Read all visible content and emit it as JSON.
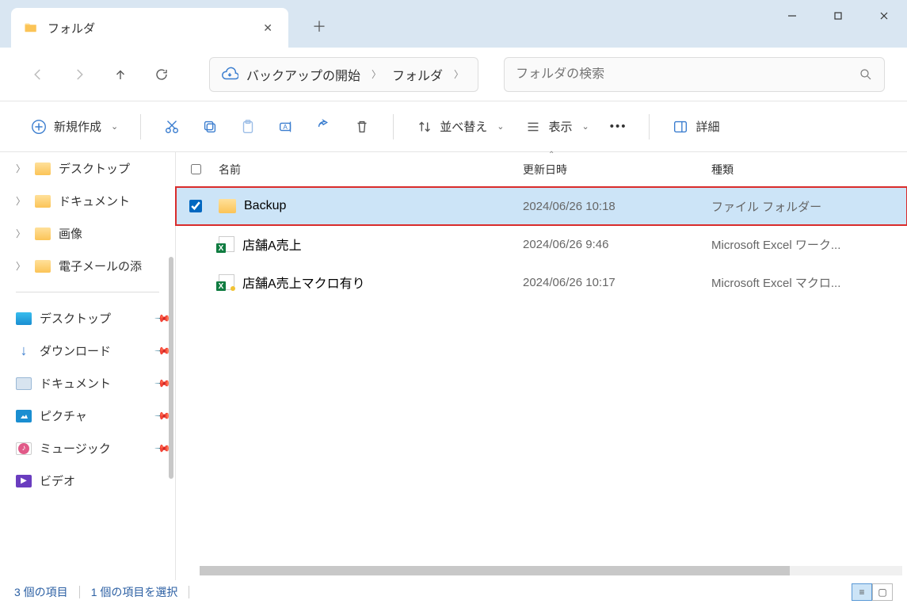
{
  "window": {
    "tab_title": "フォルダ"
  },
  "breadcrumb": {
    "root": "バックアップの開始",
    "current": "フォルダ"
  },
  "search": {
    "placeholder": "フォルダの検索"
  },
  "toolbar": {
    "new": "新規作成",
    "sort": "並べ替え",
    "view": "表示",
    "details": "詳細"
  },
  "sidebar": {
    "tree": [
      {
        "label": "デスクトップ"
      },
      {
        "label": "ドキュメント"
      },
      {
        "label": "画像"
      },
      {
        "label": "電子メールの添"
      }
    ],
    "quick": [
      {
        "label": "デスクトップ"
      },
      {
        "label": "ダウンロード"
      },
      {
        "label": "ドキュメント"
      },
      {
        "label": "ピクチャ"
      },
      {
        "label": "ミュージック"
      },
      {
        "label": "ビデオ"
      }
    ]
  },
  "columns": {
    "name": "名前",
    "date": "更新日時",
    "type": "種類"
  },
  "files": [
    {
      "name": "Backup",
      "date": "2024/06/26 10:18",
      "type": "ファイル フォルダー",
      "selected": true,
      "icon": "folder"
    },
    {
      "name": "店舗A売上",
      "date": "2024/06/26 9:46",
      "type": "Microsoft Excel ワーク...",
      "selected": false,
      "icon": "xlsx"
    },
    {
      "name": "店舗A売上マクロ有り",
      "date": "2024/06/26 10:17",
      "type": "Microsoft Excel マクロ...",
      "selected": false,
      "icon": "xlsm"
    }
  ],
  "status": {
    "items": "3 個の項目",
    "selected": "1 個の項目を選択"
  }
}
